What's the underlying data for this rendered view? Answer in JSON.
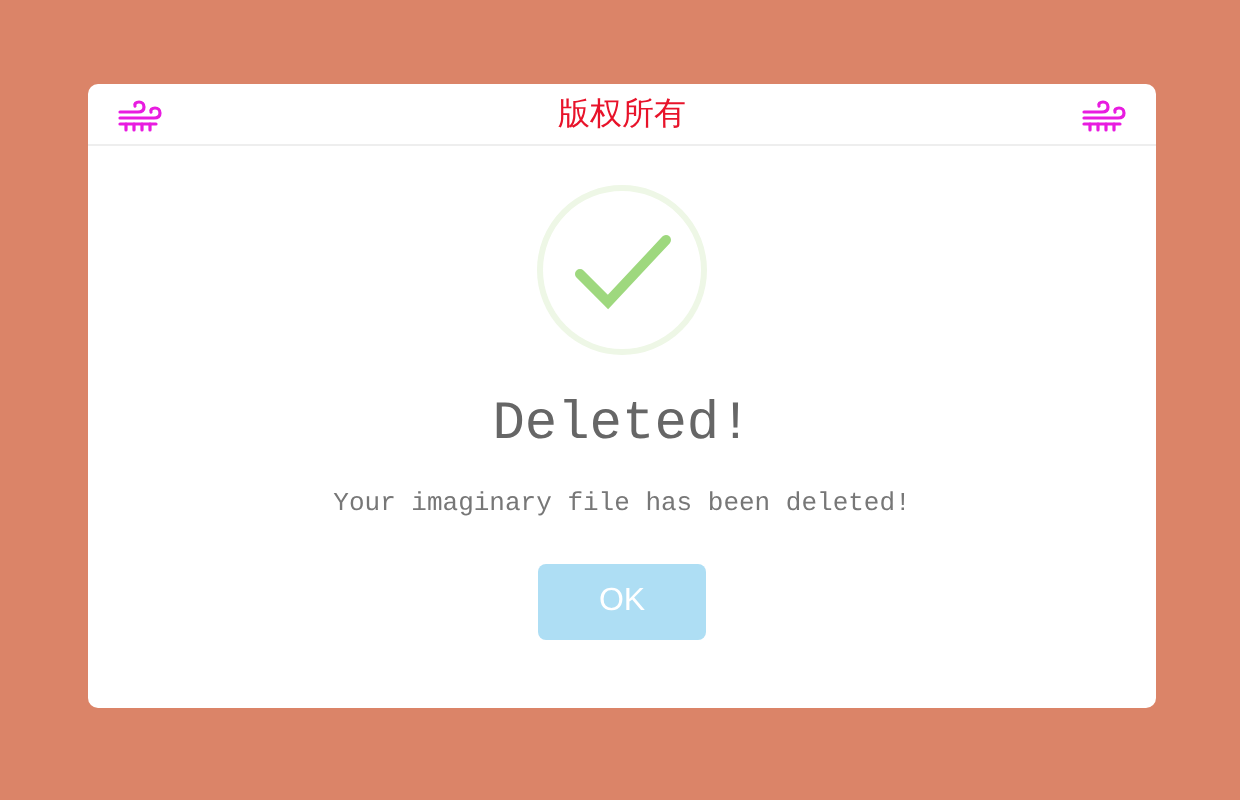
{
  "header": {
    "title": "版权所有"
  },
  "dialog": {
    "kind": "success",
    "title": "Deleted!",
    "message": "Your imaginary file has been deleted!",
    "button": "OK"
  }
}
